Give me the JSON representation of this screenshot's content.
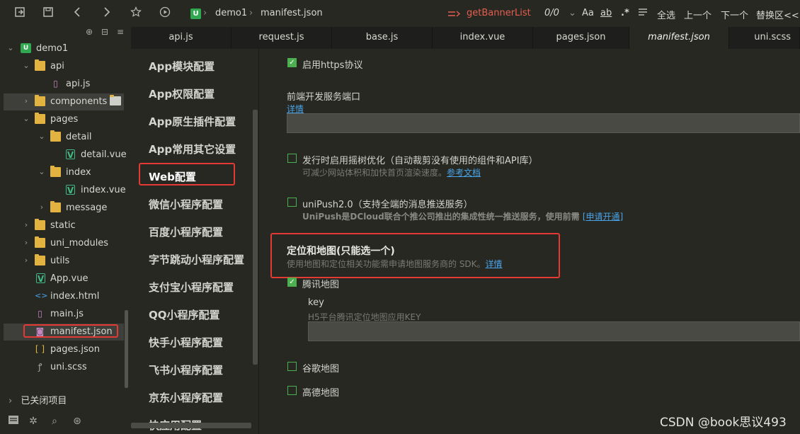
{
  "toolbar": {
    "breadcrumb_project": "demo1",
    "breadcrumb_file": "manifest.json",
    "search_term": "getBannerList",
    "match_count": "0/0",
    "case_toggle": "Aa",
    "word_toggle": "ab",
    "regex_toggle": ".*",
    "select_all": "全选",
    "prev": "上一个",
    "next": "下一个",
    "replace": "替换区<<"
  },
  "tree": {
    "items": [
      {
        "label": "demo1"
      },
      {
        "label": "api"
      },
      {
        "label": "api.js"
      },
      {
        "label": "components"
      },
      {
        "label": "pages"
      },
      {
        "label": "detail"
      },
      {
        "label": "detail.vue"
      },
      {
        "label": "index"
      },
      {
        "label": "index.vue"
      },
      {
        "label": "message"
      },
      {
        "label": "static"
      },
      {
        "label": "uni_modules"
      },
      {
        "label": "utils"
      },
      {
        "label": "App.vue"
      },
      {
        "label": "index.html"
      },
      {
        "label": "main.js"
      },
      {
        "label": "manifest.json"
      },
      {
        "label": "pages.json"
      },
      {
        "label": "uni.scss"
      }
    ],
    "closed_items": "已关闭项目"
  },
  "tabs": [
    {
      "label": "api.js"
    },
    {
      "label": "request.js"
    },
    {
      "label": "base.js"
    },
    {
      "label": "index.vue"
    },
    {
      "label": "pages.json"
    },
    {
      "label": "manifest.json"
    },
    {
      "label": "uni.scss"
    }
  ],
  "nav": {
    "items": [
      {
        "label": "App模块配置"
      },
      {
        "label": "App权限配置"
      },
      {
        "label": "App原生插件配置"
      },
      {
        "label": "App常用其它设置"
      },
      {
        "label": "Web配置"
      },
      {
        "label": "微信小程序配置"
      },
      {
        "label": "百度小程序配置"
      },
      {
        "label": "字节跳动小程序配置"
      },
      {
        "label": "支付宝小程序配置"
      },
      {
        "label": "QQ小程序配置"
      },
      {
        "label": "快手小程序配置"
      },
      {
        "label": "飞书小程序配置"
      },
      {
        "label": "京东小程序配置"
      },
      {
        "label": "快应用配置"
      }
    ],
    "active": "Web配置"
  },
  "content": {
    "https_label": "启用https协议",
    "https_checked": true,
    "port_title": "前端开发服务端口",
    "port_link": "详情",
    "port_value": "",
    "treeshake_label": "发行时启用摇树优化（自动裁剪没有使用的组件和API库）",
    "treeshake_checked": false,
    "treeshake_desc": "可减少网站体积和加快首页渲染速度。",
    "treeshake_link": "参考文档",
    "unipush_label": "uniPush2.0（支持全端的消息推送服务）",
    "unipush_checked": false,
    "unipush_desc": "UniPush是DCloud联合个推公司推出的集成性统一推送服务，使用前需",
    "unipush_link": "[申请开通]",
    "map_title": "定位和地图(只能选一个)",
    "map_desc": "使用地图和定位相关功能需申请地图服务商的 SDK。",
    "map_link": "详情",
    "tencent_label": "腾讯地图",
    "tencent_checked": true,
    "key_label": "key",
    "key_desc": "H5平台腾讯定位地图应用KEY",
    "key_value": "",
    "google_label": "谷歌地图",
    "google_checked": false,
    "amap_label": "高德地图",
    "amap_checked": false
  },
  "watermark": "CSDN @book思议493",
  "colors": {
    "background": "#272822",
    "tab_bar": "#1e1f1c",
    "checkbox": "#4caf50",
    "link": "#4aa3e8",
    "highlight_box": "#e53935",
    "search_text": "#e55e4f"
  }
}
